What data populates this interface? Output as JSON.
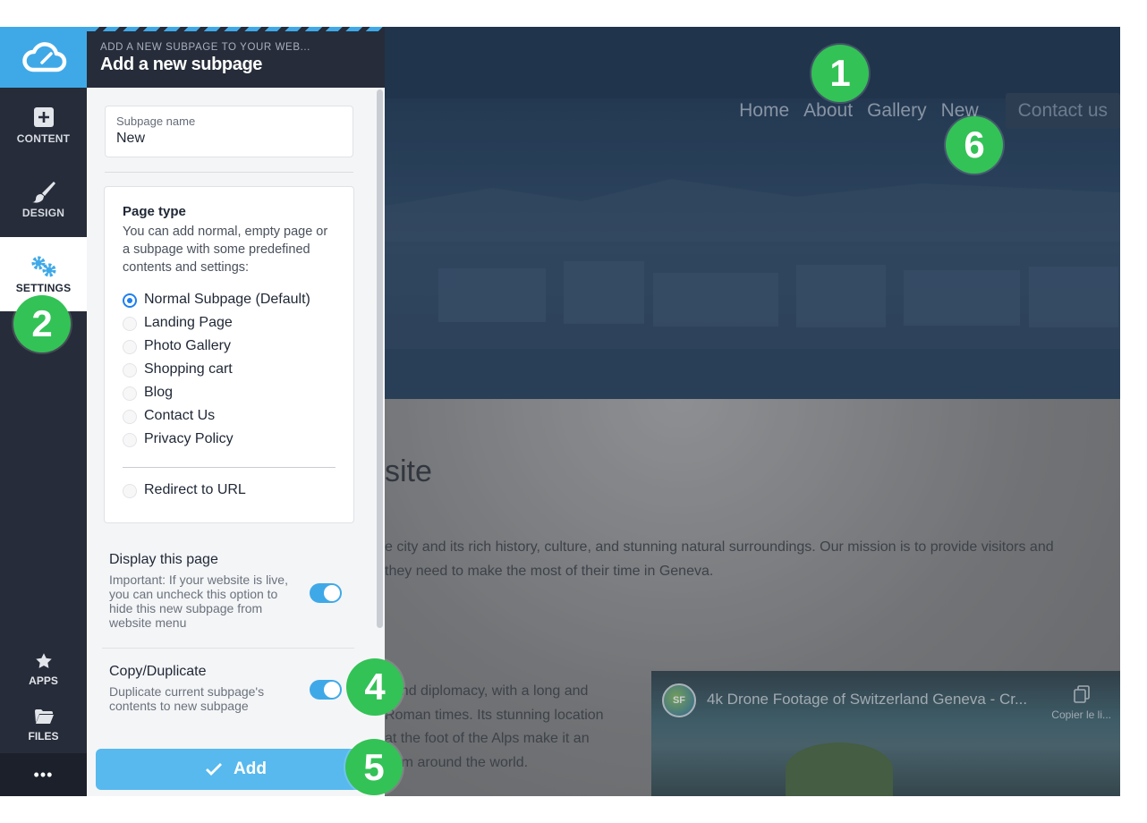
{
  "rail": {
    "content_label": "CONTENT",
    "design_label": "DESIGN",
    "settings_label": "SETTINGS",
    "apps_label": "APPS",
    "files_label": "FILES",
    "more_label": "•••"
  },
  "panel": {
    "subtitle": "ADD A NEW SUBPAGE TO YOUR WEB...",
    "title": "Add a new subpage",
    "name_field": {
      "label": "Subpage name",
      "value": "New"
    },
    "page_type": {
      "heading": "Page type",
      "description": "You can add normal, empty page or a subpage with some predefined contents and settings:",
      "options": [
        "Normal Subpage (Default)",
        "Landing Page",
        "Photo Gallery",
        "Shopping cart",
        "Blog",
        "Contact Us",
        "Privacy Policy"
      ],
      "selected": "Normal Subpage (Default)",
      "redirect_option": "Redirect to URL"
    },
    "display": {
      "title": "Display this page",
      "description": "Important: If your website is live, you can uncheck this option to hide this new subpage from website menu",
      "enabled": true
    },
    "duplicate": {
      "title": "Copy/Duplicate",
      "description": "Duplicate current subpage's contents to new subpage",
      "enabled": true
    },
    "add_button": "Add"
  },
  "preview": {
    "nav": [
      "Home",
      "About",
      "Gallery",
      "New"
    ],
    "contact": "Contact us",
    "headline": "site",
    "paragraph1": "e city and its rich history, culture, and stunning natural surroundings. Our mission is to provide visitors and",
    "paragraph2": "they need to make the most of their time in Geneva.",
    "paragraph3": [
      ", and diplomacy, with a long and",
      "Roman times. Its stunning location",
      "at the foot of the Alps make it an",
      "from around the world."
    ],
    "video_title": "4k Drone Footage of Switzerland Geneva - Cr...",
    "video_copy": "Copier le li..."
  },
  "callouts": [
    "1",
    "2",
    "4",
    "5",
    "6"
  ],
  "colors": {
    "accent": "#3fa9e8",
    "rail": "#262c39",
    "badge": "#33c256",
    "radio": "#1e7ff0"
  }
}
